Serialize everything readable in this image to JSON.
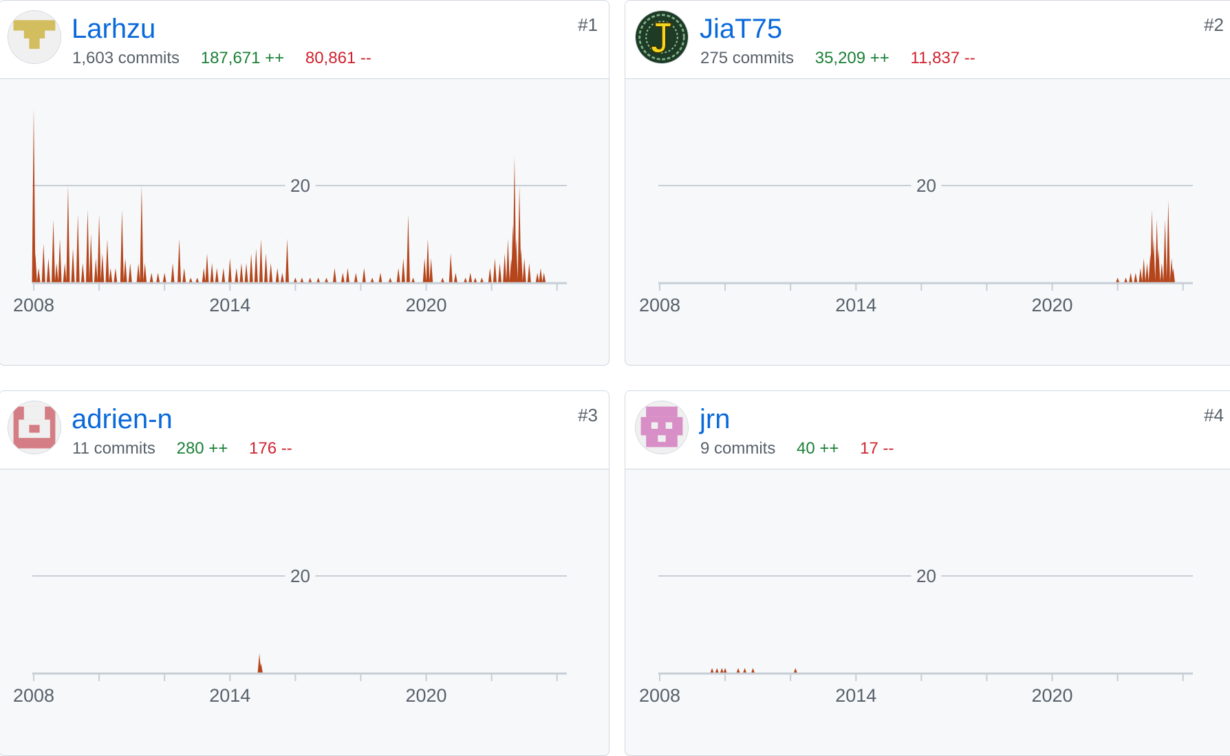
{
  "colors": {
    "link": "#0969da",
    "additions": "#1a7f37",
    "deletions": "#cf222e",
    "bars": "#b5451b",
    "grid": "#c7ced6",
    "axis_text": "#57606a"
  },
  "contributors": [
    {
      "rank": "#1",
      "name": "Larhzu",
      "avatar": "yellow-identicon-avatar",
      "commits": "1,603 commits",
      "additions": "187,671 ++",
      "deletions": "80,861 --"
    },
    {
      "rank": "#2",
      "name": "JiaT75",
      "avatar": "celtic-letter-j-avatar",
      "commits": "275 commits",
      "additions": "35,209 ++",
      "deletions": "11,837 --"
    },
    {
      "rank": "#3",
      "name": "adrien-n",
      "avatar": "red-identicon-avatar",
      "commits": "11 commits",
      "additions": "280 ++",
      "deletions": "176 --"
    },
    {
      "rank": "#4",
      "name": "jrn",
      "avatar": "pink-identicon-avatar",
      "commits": "9 commits",
      "additions": "40 ++",
      "deletions": "17 --"
    }
  ],
  "chart_data": [
    {
      "type": "area",
      "x_ticks": [
        "2008",
        "2014",
        "2020"
      ],
      "xlim": [
        2008,
        2024.3
      ],
      "y_ticks": [
        20
      ],
      "ylim": [
        0,
        20
      ],
      "series": [
        {
          "points": [
            [
              2008.0,
              36
            ],
            [
              2008.05,
              6
            ],
            [
              2008.15,
              3
            ],
            [
              2008.3,
              8
            ],
            [
              2008.45,
              5
            ],
            [
              2008.6,
              13
            ],
            [
              2008.7,
              4
            ],
            [
              2008.8,
              9
            ],
            [
              2008.95,
              4
            ],
            [
              2009.05,
              20
            ],
            [
              2009.2,
              7
            ],
            [
              2009.35,
              14
            ],
            [
              2009.5,
              4
            ],
            [
              2009.65,
              15
            ],
            [
              2009.75,
              10
            ],
            [
              2009.9,
              5
            ],
            [
              2010.0,
              14
            ],
            [
              2010.1,
              6
            ],
            [
              2010.25,
              9
            ],
            [
              2010.35,
              3
            ],
            [
              2010.5,
              3
            ],
            [
              2010.7,
              15
            ],
            [
              2010.8,
              5
            ],
            [
              2010.95,
              4
            ],
            [
              2011.2,
              4
            ],
            [
              2011.3,
              20
            ],
            [
              2011.4,
              4
            ],
            [
              2011.6,
              2
            ],
            [
              2011.8,
              2
            ],
            [
              2012.0,
              2
            ],
            [
              2012.25,
              4
            ],
            [
              2012.45,
              9
            ],
            [
              2012.6,
              3
            ],
            [
              2012.8,
              1
            ],
            [
              2013.0,
              1
            ],
            [
              2013.2,
              3
            ],
            [
              2013.3,
              6
            ],
            [
              2013.45,
              4
            ],
            [
              2013.6,
              3
            ],
            [
              2013.8,
              3
            ],
            [
              2014.0,
              5
            ],
            [
              2014.2,
              3
            ],
            [
              2014.35,
              4
            ],
            [
              2014.5,
              4
            ],
            [
              2014.65,
              6
            ],
            [
              2014.8,
              7
            ],
            [
              2014.95,
              9
            ],
            [
              2015.1,
              6
            ],
            [
              2015.25,
              4
            ],
            [
              2015.45,
              3
            ],
            [
              2015.6,
              2
            ],
            [
              2015.75,
              9
            ],
            [
              2016.0,
              1
            ],
            [
              2016.2,
              1
            ],
            [
              2016.45,
              1
            ],
            [
              2016.7,
              1
            ],
            [
              2016.95,
              1
            ],
            [
              2017.2,
              3
            ],
            [
              2017.45,
              2
            ],
            [
              2017.6,
              3
            ],
            [
              2017.85,
              2
            ],
            [
              2018.1,
              3
            ],
            [
              2018.35,
              1
            ],
            [
              2018.6,
              2
            ],
            [
              2018.9,
              1
            ],
            [
              2019.15,
              3
            ],
            [
              2019.3,
              5
            ],
            [
              2019.45,
              14
            ],
            [
              2019.6,
              1
            ],
            [
              2019.95,
              5
            ],
            [
              2020.05,
              9
            ],
            [
              2020.15,
              5
            ],
            [
              2020.5,
              1
            ],
            [
              2020.75,
              6
            ],
            [
              2020.9,
              2
            ],
            [
              2021.2,
              1
            ],
            [
              2021.35,
              2
            ],
            [
              2021.5,
              1
            ],
            [
              2021.7,
              1
            ],
            [
              2021.95,
              3
            ],
            [
              2022.1,
              5
            ],
            [
              2022.25,
              4
            ],
            [
              2022.4,
              6
            ],
            [
              2022.5,
              9
            ],
            [
              2022.6,
              5
            ],
            [
              2022.65,
              12
            ],
            [
              2022.7,
              26
            ],
            [
              2022.75,
              9
            ],
            [
              2022.85,
              20
            ],
            [
              2022.9,
              7
            ],
            [
              2023.0,
              5
            ],
            [
              2023.15,
              4
            ],
            [
              2023.4,
              2
            ],
            [
              2023.5,
              3
            ],
            [
              2023.6,
              2
            ]
          ]
        }
      ]
    },
    {
      "type": "area",
      "x_ticks": [
        "2008",
        "2014",
        "2020"
      ],
      "xlim": [
        2008,
        2024.3
      ],
      "y_ticks": [
        20
      ],
      "ylim": [
        0,
        20
      ],
      "series": [
        {
          "points": [
            [
              2022.0,
              1
            ],
            [
              2022.25,
              1
            ],
            [
              2022.4,
              2
            ],
            [
              2022.55,
              2
            ],
            [
              2022.7,
              3
            ],
            [
              2022.8,
              5
            ],
            [
              2022.9,
              4
            ],
            [
              2023.0,
              6
            ],
            [
              2023.05,
              15
            ],
            [
              2023.1,
              9
            ],
            [
              2023.2,
              13
            ],
            [
              2023.25,
              7
            ],
            [
              2023.35,
              4
            ],
            [
              2023.45,
              13
            ],
            [
              2023.55,
              17
            ],
            [
              2023.65,
              5
            ],
            [
              2023.7,
              3
            ]
          ]
        }
      ]
    },
    {
      "type": "area",
      "x_ticks": [
        "2008",
        "2014",
        "2020"
      ],
      "xlim": [
        2008,
        2024.3
      ],
      "y_ticks": [
        20
      ],
      "ylim": [
        0,
        20
      ],
      "series": [
        {
          "points": [
            [
              2014.9,
              4
            ],
            [
              2014.95,
              2
            ]
          ]
        }
      ]
    },
    {
      "type": "area",
      "x_ticks": [
        "2008",
        "2014",
        "2020"
      ],
      "xlim": [
        2008,
        2024.3
      ],
      "y_ticks": [
        20
      ],
      "ylim": [
        0,
        20
      ],
      "series": [
        {
          "points": [
            [
              2009.6,
              1
            ],
            [
              2009.75,
              1
            ],
            [
              2009.9,
              1
            ],
            [
              2010.0,
              1
            ],
            [
              2010.4,
              1
            ],
            [
              2010.6,
              1
            ],
            [
              2010.85,
              1
            ],
            [
              2012.15,
              1
            ]
          ]
        }
      ]
    }
  ]
}
